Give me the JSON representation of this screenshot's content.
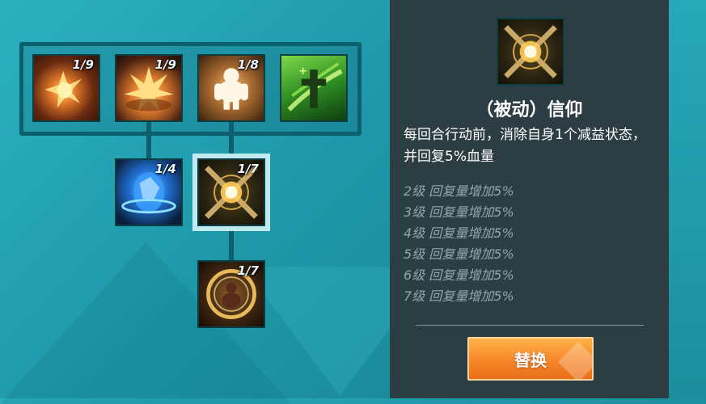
{
  "skill_tree": {
    "row1": [
      {
        "name": "explosion-skill",
        "level": "1/9"
      },
      {
        "name": "burst-skill",
        "level": "1/9"
      },
      {
        "name": "golem-skill",
        "level": "1/8"
      },
      {
        "name": "cross-heal-skill",
        "level": ""
      }
    ],
    "row2": [
      {
        "name": "shield-skill",
        "level": "1/4"
      },
      {
        "name": "faith-skill",
        "level": "1/7"
      }
    ],
    "row3": [
      {
        "name": "guardian-skill",
        "level": "1/7"
      }
    ]
  },
  "detail": {
    "title": "（被动）信仰",
    "description": "每回合行动前，消除自身1个减益状态，并回复5%血量",
    "levels": [
      "2级 回复量增加5%",
      "3级 回复量增加5%",
      "4级 回复量增加5%",
      "5级 回复量增加5%",
      "6级 回复量增加5%",
      "7级 回复量增加5%"
    ],
    "replace_label": "替换"
  },
  "colors": {
    "panel_bg": "#2c3e44",
    "accent_orange": "#f7862a",
    "frame_teal": "#0c5f6c"
  }
}
